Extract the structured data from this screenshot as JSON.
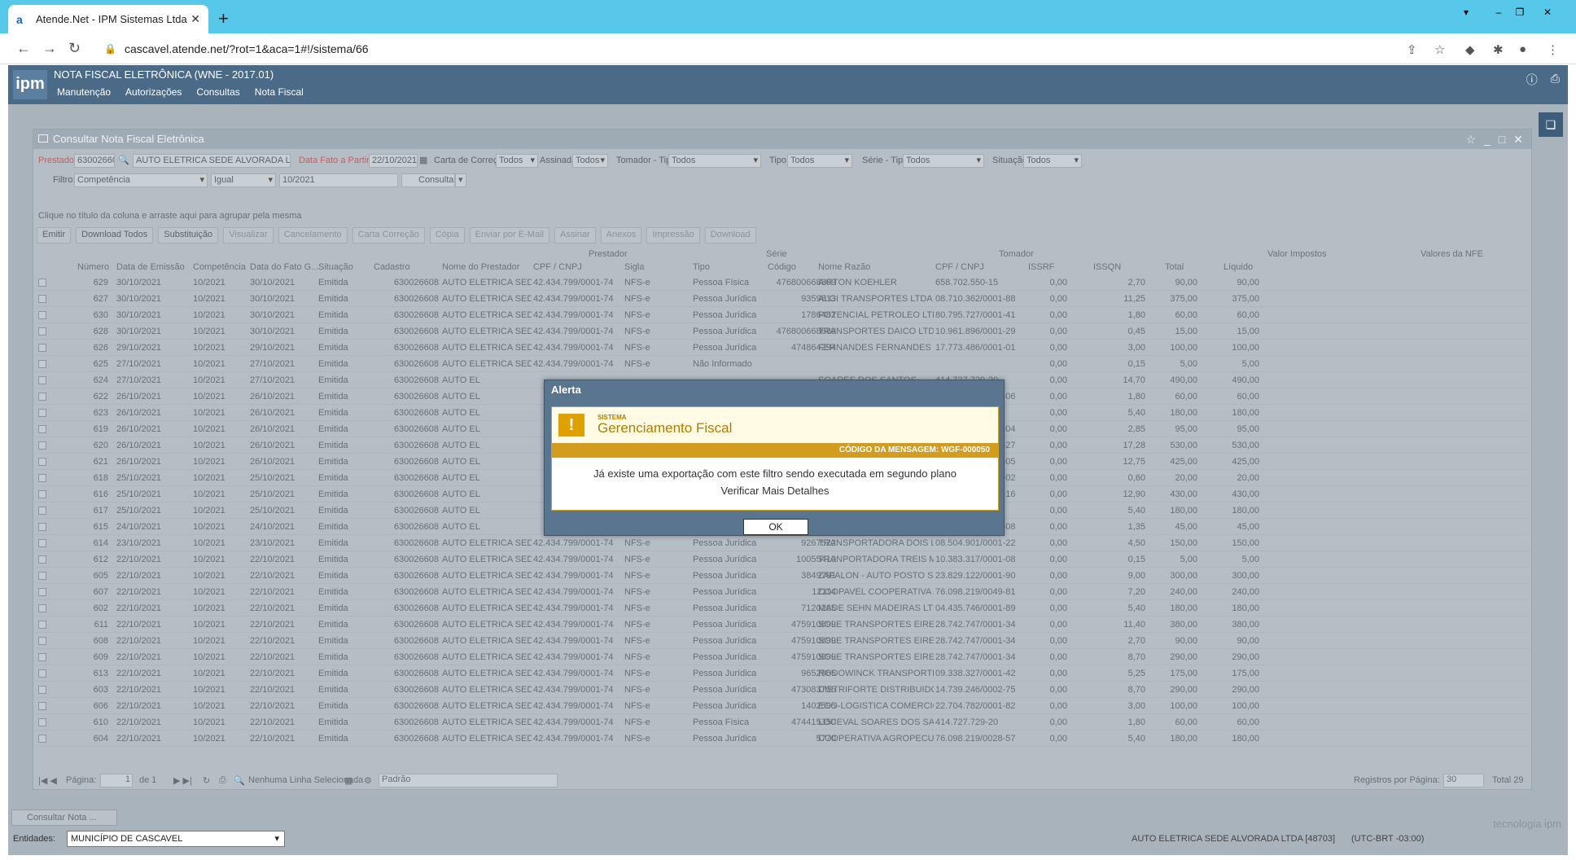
{
  "browser": {
    "tab_title": "Atende.Net - IPM Sistemas Ltda",
    "url": "cascavel.atende.net/?rot=1&aca=1#!/sistema/66"
  },
  "app": {
    "logo": "ipm",
    "title": "NOTA FISCAL ELETRÔNICA (WNE - 2017.01)",
    "menu": [
      "Manutenção",
      "Autorizações",
      "Consultas",
      "Nota Fiscal"
    ]
  },
  "window": {
    "title": "Consultar Nota Fiscal Eletrônica"
  },
  "filters": {
    "prestador_label": "Prestador:",
    "prestador_code": "630026608",
    "prestador_name": "AUTO ELETRICA SEDE ALVORADA LTDA",
    "data_fato_label": "Data Fato a Partir de:",
    "data_fato": "22/10/2021",
    "carta_label": "Carta de Correção:",
    "carta": "Todos",
    "assinada_label": "Assinada:",
    "assinada": "Todos",
    "tomador_tipo_label": "Tomador - Tipo:",
    "tomador_tipo": "Todos",
    "tipo_label": "Tipo:",
    "tipo": "Todos",
    "serie_tipo_label": "Série - Tipo:",
    "serie_tipo": "Todos",
    "situacao_label": "Situação:",
    "situacao": "Todos",
    "filtro_label": "Filtro:",
    "filtro": "Competência",
    "operador": "Igual",
    "valor": "10/2021",
    "consultar": "Consultar"
  },
  "group_hint": "Clique no título da coluna e arraste aqui para agrupar pela mesma",
  "toolbar": [
    "Emitir",
    "Download Todos",
    "Substituição",
    "Visualizar",
    "Cancelamento",
    "Carta Correção",
    "Cópia",
    "Enviar por E-Mail",
    "Assinar",
    "Anexos",
    "Impressão",
    "Download"
  ],
  "grid": {
    "group_headers": [
      "Prestador",
      "Série",
      "Tomador",
      "Valor Impostos",
      "Valores da NFE"
    ],
    "headers": [
      "Número",
      "Data de Emissão",
      "Competência",
      "Data do Fato G...",
      "Situação",
      "Cadastro",
      "Nome do Prestador",
      "CPF / CNPJ",
      "Sigla",
      "Tipo",
      "Código",
      "Nome Razão",
      "CPF / CNPJ",
      "ISSRF",
      "ISSQN",
      "Total",
      "Líquido"
    ],
    "rows": [
      [
        "629",
        "30/10/2021",
        "10/2021",
        "30/10/2021",
        "Emitida",
        "630026608",
        "AUTO ELETRICA SEDE AL...",
        "42.434.799/0001-74",
        "NFS-e",
        "Pessoa Física",
        "476800668809",
        "AIRTON KOEHLER",
        "658.702.550-15",
        "0,00",
        "2,70",
        "90,00",
        "90,00"
      ],
      [
        "627",
        "30/10/2021",
        "10/2021",
        "30/10/2021",
        "Emitida",
        "630026608",
        "AUTO ELETRICA SEDE AL...",
        "42.434.799/0001-74",
        "NFS-e",
        "Pessoa Jurídica",
        "9359613",
        "ALGI TRANSPORTES LTDA",
        "08.710.362/0001-88",
        "0,00",
        "11,25",
        "375,00",
        "375,00"
      ],
      [
        "630",
        "30/10/2021",
        "10/2021",
        "30/10/2021",
        "Emitida",
        "630026608",
        "AUTO ELETRICA SEDE AL...",
        "42.434.799/0001-74",
        "NFS-e",
        "Pessoa Jurídica",
        "1786482",
        "POTENCIAL PETROLEO LTDA",
        "80.795.727/0001-41",
        "0,00",
        "1,80",
        "60,00",
        "60,00"
      ],
      [
        "628",
        "30/10/2021",
        "10/2021",
        "30/10/2021",
        "Emitida",
        "630026608",
        "AUTO ELETRICA SEDE AL...",
        "42.434.799/0001-74",
        "NFS-e",
        "Pessoa Jurídica",
        "476800668689",
        "TRANSPORTES DAICO LTDA",
        "10.961.896/0001-29",
        "0,00",
        "0,45",
        "15,00",
        "15,00"
      ],
      [
        "626",
        "29/10/2021",
        "10/2021",
        "29/10/2021",
        "Emitida",
        "630026608",
        "AUTO ELETRICA SEDE AL...",
        "42.434.799/0001-74",
        "NFS-e",
        "Pessoa Jurídica",
        "474864294",
        "FERNANDES FERNANDES TRAN...",
        "17.773.486/0001-01",
        "0,00",
        "3,00",
        "100,00",
        "100,00"
      ],
      [
        "625",
        "27/10/2021",
        "10/2021",
        "27/10/2021",
        "Emitida",
        "630026608",
        "AUTO ELETRICA SEDE AL...",
        "42.434.799/0001-74",
        "NFS-e",
        "Não Informado",
        "",
        "",
        "",
        "0,00",
        "0,15",
        "5,00",
        "5,00"
      ],
      [
        "624",
        "27/10/2021",
        "10/2021",
        "27/10/2021",
        "Emitida",
        "630026608",
        "AUTO EL",
        "",
        "",
        "",
        "",
        "SOARES DOS SANTOS",
        "414.727.729-20",
        "0,00",
        "14,70",
        "490,00",
        "490,00"
      ],
      [
        "622",
        "26/10/2021",
        "10/2021",
        "26/10/2021",
        "Emitida",
        "630026608",
        "AUTO EL",
        "",
        "",
        "",
        "",
        "IMP E EXP LTDA EPP",
        "04.349.779/0001-06",
        "0,00",
        "1,80",
        "60,00",
        "60,00"
      ],
      [
        "623",
        "26/10/2021",
        "10/2021",
        "26/10/2021",
        "Emitida",
        "630026608",
        "AUTO EL",
        "",
        "",
        "",
        "",
        "O VANDERLEI KASPER",
        "052.622.069-48",
        "0,00",
        "5,40",
        "180,00",
        "180,00"
      ],
      [
        "619",
        "26/10/2021",
        "10/2021",
        "26/10/2021",
        "Emitida",
        "630026608",
        "AUTO EL",
        "",
        "",
        "",
        "",
        "PRESSO LTDA",
        "04.496.053/0001-04",
        "0,00",
        "2,85",
        "95,00",
        "95,00"
      ],
      [
        "620",
        "26/10/2021",
        "10/2021",
        "26/10/2021",
        "Emitida",
        "630026608",
        "AUTO EL",
        "",
        "",
        "",
        "",
        "TI TRANSPORTES LTDA...",
        "33.779.236/0001-27",
        "0,00",
        "17,28",
        "530,00",
        "530,00"
      ],
      [
        "621",
        "26/10/2021",
        "10/2021",
        "26/10/2021",
        "Emitida",
        "630026608",
        "AUTO EL",
        "",
        "",
        "",
        "",
        "RTADORA RAMILAND...",
        "43.194.358/0001-05",
        "0,00",
        "12,75",
        "425,00",
        "425,00"
      ],
      [
        "618",
        "25/10/2021",
        "10/2021",
        "25/10/2021",
        "Emitida",
        "630026608",
        "AUTO EL",
        "",
        "",
        "",
        "",
        "RA DO BRASIL COMER...",
        "73.702.771/0002-02",
        "0,00",
        "0,60",
        "20,00",
        "20,00"
      ],
      [
        "616",
        "25/10/2021",
        "10/2021",
        "25/10/2021",
        "Emitida",
        "630026608",
        "AUTO EL",
        "",
        "",
        "",
        "",
        "E TRANSPORTES - EIR...",
        "07.780.293/0001-16",
        "0,00",
        "12,90",
        "430,00",
        "430,00"
      ],
      [
        "617",
        "25/10/2021",
        "10/2021",
        "25/10/2021",
        "Emitida",
        "630026608",
        "AUTO EL",
        "",
        "",
        "",
        "",
        "OSE FIORESE",
        "046.571.409-90",
        "0,00",
        "5,40",
        "180,00",
        "180,00"
      ],
      [
        "615",
        "24/10/2021",
        "10/2021",
        "24/10/2021",
        "Emitida",
        "630026608",
        "AUTO EL",
        "",
        "",
        "",
        "",
        "TADORA TREIS MARC...",
        "10.383.317/0001-08",
        "0,00",
        "1,35",
        "45,00",
        "45,00"
      ],
      [
        "614",
        "23/10/2021",
        "10/2021",
        "23/10/2021",
        "Emitida",
        "630026608",
        "AUTO ELETRICA SEDE AL...",
        "42.434.799/0001-74",
        "NFS-e",
        "Pessoa Jurídica",
        "9267522",
        "TRANSPORTADORA DOIS LAJE...",
        "08.504.901/0001-22",
        "0,00",
        "4,50",
        "150,00",
        "150,00"
      ],
      [
        "612",
        "22/10/2021",
        "10/2021",
        "22/10/2021",
        "Emitida",
        "630026608",
        "AUTO ELETRICA SEDE AL...",
        "42.434.799/0001-74",
        "NFS-e",
        "Pessoa Jurídica",
        "10055410",
        "TRANPORTADORA TREIS MARC...",
        "10.383.317/0001-08",
        "0,00",
        "0,15",
        "5,00",
        "5,00"
      ],
      [
        "605",
        "22/10/2021",
        "10/2021",
        "22/10/2021",
        "Emitida",
        "630026608",
        "AUTO ELETRICA SEDE AL...",
        "42.434.799/0001-74",
        "NFS-e",
        "Pessoa Jurídica",
        "3849791",
        "ZAFALON - AUTO POSTO SEDE ...",
        "23.829.122/0001-90",
        "0,00",
        "9,00",
        "300,00",
        "300,00"
      ],
      [
        "607",
        "22/10/2021",
        "10/2021",
        "22/10/2021",
        "Emitida",
        "630026608",
        "AUTO ELETRICA SEDE AL...",
        "42.434.799/0001-74",
        "NFS-e",
        "Pessoa Jurídica",
        "12114",
        "COOPAVEL COOPERATIVA AGR...",
        "76.098.219/0049-81",
        "0,00",
        "7,20",
        "240,00",
        "240,00"
      ],
      [
        "602",
        "22/10/2021",
        "10/2021",
        "22/10/2021",
        "Emitida",
        "630026608",
        "AUTO ELETRICA SEDE AL...",
        "42.434.799/0001-74",
        "NFS-e",
        "Pessoa Jurídica",
        "7120265",
        "MADE SEHN MADEIRAS LTDA",
        "04.435.746/0001-89",
        "0,00",
        "5,40",
        "180,00",
        "180,00"
      ],
      [
        "611",
        "22/10/2021",
        "10/2021",
        "22/10/2021",
        "Emitida",
        "630026608",
        "AUTO ELETRICA SEDE AL...",
        "42.434.799/0001-74",
        "NFS-e",
        "Pessoa Jurídica",
        "475910699",
        "SOLE TRANSPORTES EIRELI 10...",
        "28.742.747/0001-34",
        "0,00",
        "11,40",
        "380,00",
        "380,00"
      ],
      [
        "608",
        "22/10/2021",
        "10/2021",
        "22/10/2021",
        "Emitida",
        "630026608",
        "AUTO ELETRICA SEDE AL...",
        "42.434.799/0001-74",
        "NFS-e",
        "Pessoa Jurídica",
        "475910699",
        "SOLE TRANSPORTES EIRELI 10...",
        "28.742.747/0001-34",
        "0,00",
        "2,70",
        "90,00",
        "90,00"
      ],
      [
        "609",
        "22/10/2021",
        "10/2021",
        "22/10/2021",
        "Emitida",
        "630026608",
        "AUTO ELETRICA SEDE AL...",
        "42.434.799/0001-74",
        "NFS-e",
        "Pessoa Jurídica",
        "475910699",
        "SOLE TRANSPORTES EIRELI 10...",
        "28.742.747/0001-34",
        "0,00",
        "8,70",
        "290,00",
        "290,00"
      ],
      [
        "613",
        "22/10/2021",
        "10/2021",
        "22/10/2021",
        "Emitida",
        "630026608",
        "AUTO ELETRICA SEDE AL...",
        "42.434.799/0001-74",
        "NFS-e",
        "Pessoa Jurídica",
        "9652965",
        "RODOWINCK TRANSPORTES LT...",
        "09.338.327/0001-42",
        "0,00",
        "5,25",
        "175,00",
        "175,00"
      ],
      [
        "603",
        "22/10/2021",
        "10/2021",
        "22/10/2021",
        "Emitida",
        "630026608",
        "AUTO ELETRICA SEDE AL...",
        "42.434.799/0001-74",
        "NFS-e",
        "Pessoa Jurídica",
        "473083795",
        "DISTRIFORTE DISTRIBUIDORA ...",
        "14.739.246/0002-75",
        "0,00",
        "8,70",
        "290,00",
        "290,00"
      ],
      [
        "606",
        "22/10/2021",
        "10/2021",
        "22/10/2021",
        "Emitida",
        "630026608",
        "AUTO ELETRICA SEDE AL...",
        "42.434.799/0001-74",
        "NFS-e",
        "Pessoa Jurídica",
        "1402595",
        "ECO-LOGISTICA COMERCIO DE ...",
        "22.704.782/0001-82",
        "0,00",
        "3,00",
        "100,00",
        "100,00"
      ],
      [
        "610",
        "22/10/2021",
        "10/2021",
        "22/10/2021",
        "Emitida",
        "630026608",
        "AUTO ELETRICA SEDE AL...",
        "42.434.799/0001-74",
        "NFS-e",
        "Pessoa Física",
        "474415350",
        "LOCEVAL SOARES DOS SANTOS",
        "414.727.729-20",
        "0,00",
        "1,80",
        "60,00",
        "60,00"
      ],
      [
        "604",
        "22/10/2021",
        "10/2021",
        "22/10/2021",
        "Emitida",
        "630026608",
        "AUTO ELETRICA SEDE AL...",
        "42.434.799/0001-74",
        "NFS-e",
        "Pessoa Jurídica",
        "5770",
        "COOPERATIVA AGROPECUARIA...",
        "76.098.219/0028-57",
        "0,00",
        "5,40",
        "180,00",
        "180,00"
      ]
    ]
  },
  "pager": {
    "page_label": "Página:",
    "page": "1",
    "of": "de 1",
    "selection": "Nenhuma Linha Selecionada",
    "layout": "Padrão",
    "per_page_label": "Registros por Página:",
    "per_page": "30",
    "total": "Total 29"
  },
  "taskbar": {
    "item": "Consultar Nota ...",
    "entidades_label": "Entidades:",
    "entidade": "MUNICÍPIO DE CASCAVEL",
    "user": "AUTO ELETRICA SEDE ALVORADA LTDA [48703]",
    "timezone": "(UTC-BRT -03:00)",
    "brand": "tecnologia ipm"
  },
  "modal": {
    "title": "Alerta",
    "system_label": "SISTEMA",
    "heading": "Gerenciamento Fiscal",
    "code": "CÓDIGO DA MENSAGEM: WGF-000050",
    "message": "Já existe uma exportação com este filtro sendo executada em segundo plano",
    "details": "Verificar Mais Detalhes",
    "ok": "OK"
  }
}
